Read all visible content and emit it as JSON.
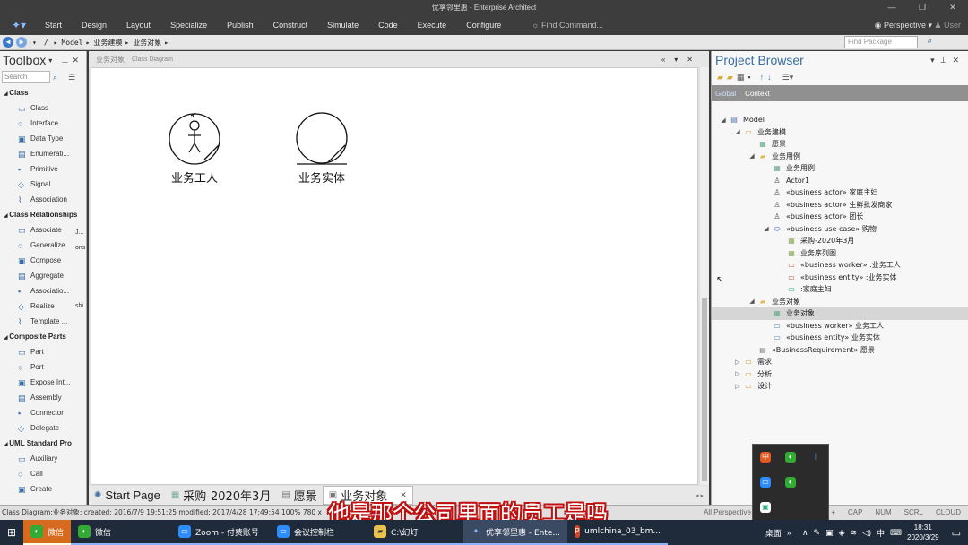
{
  "window": {
    "title": "优享邻里惠 - Enterprise Architect"
  },
  "menu": {
    "items": [
      "Start",
      "Design",
      "Layout",
      "Specialize",
      "Publish",
      "Construct",
      "Simulate",
      "Code",
      "Execute",
      "Configure"
    ],
    "find": "Find Command...",
    "perspective": "Perspective",
    "user": "User"
  },
  "nav": {
    "path": [
      "/",
      "Model",
      "业务建模",
      "业务对象"
    ],
    "find_package": "Find Package"
  },
  "toolbox": {
    "title": "Toolbox",
    "search": "Search",
    "sections": [
      {
        "title": "Class",
        "items": [
          "Class",
          "Interface",
          "Data Type",
          "Enumerati...",
          "Primitive",
          "Signal",
          "Association"
        ]
      },
      {
        "title": "Class Relationships",
        "items": [
          "Associate",
          "Generalize",
          "Compose",
          "Aggregate",
          "Associatio...",
          "Realize",
          "Template ..."
        ]
      },
      {
        "title": "Composite Parts",
        "items": [
          "Part",
          "Port",
          "Expose Int...",
          "Assembly",
          "Connector",
          "Delegate"
        ]
      },
      {
        "title": "UML Standard Pro",
        "items": [
          "Auxiliary",
          "Call",
          "Create"
        ]
      }
    ],
    "frags": [
      "J...",
      "ons",
      "shi"
    ]
  },
  "diagram": {
    "tab_name": "业务对象",
    "tab_type": "Class Diagram",
    "worker_label": "业务工人",
    "entity_label": "业务实体",
    "bottom_tabs": [
      "Start Page",
      "采购-2020年3月",
      "愿景",
      "业务对象"
    ]
  },
  "browser": {
    "title": "Project Browser",
    "tabs": [
      "Global",
      "Context"
    ],
    "tree": [
      {
        "label": "Model",
        "level": 0,
        "toggle": "◢",
        "icon": "model"
      },
      {
        "label": "业务建模",
        "level": 1,
        "toggle": "◢",
        "icon": "package"
      },
      {
        "label": "愿景",
        "level": 2,
        "toggle": "",
        "icon": "diagram"
      },
      {
        "label": "业务用例",
        "level": 2,
        "toggle": "◢",
        "icon": "folder"
      },
      {
        "label": "业务用例",
        "level": 3,
        "toggle": "",
        "icon": "diagram"
      },
      {
        "label": "Actor1",
        "level": 3,
        "toggle": "",
        "icon": "actor"
      },
      {
        "label": "«business actor» 家庭主妇",
        "level": 3,
        "toggle": "",
        "icon": "actor"
      },
      {
        "label": "«business actor» 生鲜批发商家",
        "level": 3,
        "toggle": "",
        "icon": "actor"
      },
      {
        "label": "«business actor» 团长",
        "level": 3,
        "toggle": "",
        "icon": "actor"
      },
      {
        "label": "«business use case» 购物",
        "level": 3,
        "toggle": "◢",
        "icon": "usecase"
      },
      {
        "label": "采购-2020年3月",
        "level": 4,
        "toggle": "",
        "icon": "seqdiag"
      },
      {
        "label": "业务序列图",
        "level": 4,
        "toggle": "",
        "icon": "seqdiag"
      },
      {
        "label": "«business worker» :业务工人",
        "level": 4,
        "toggle": "",
        "icon": "instance"
      },
      {
        "label": "«business entity» :业务实体",
        "level": 4,
        "toggle": "",
        "icon": "instance"
      },
      {
        "label": ":家庭主妇",
        "level": 4,
        "toggle": "",
        "icon": "lifeline"
      },
      {
        "label": "业务对象",
        "level": 2,
        "toggle": "◢",
        "icon": "folder"
      },
      {
        "label": "业务对象",
        "level": 3,
        "toggle": "",
        "icon": "diagram",
        "selected": true
      },
      {
        "label": "«business worker» 业务工人",
        "level": 3,
        "toggle": "",
        "icon": "class"
      },
      {
        "label": "«business entity» 业务实体",
        "level": 3,
        "toggle": "",
        "icon": "class"
      },
      {
        "label": "«BusinessRequirement» 愿景",
        "level": 2,
        "toggle": "",
        "icon": "req"
      },
      {
        "label": "需求",
        "level": 1,
        "toggle": "▷",
        "icon": "package"
      },
      {
        "label": "分析",
        "level": 1,
        "toggle": "▷",
        "icon": "package"
      },
      {
        "label": "设计",
        "level": 1,
        "toggle": "▷",
        "icon": "package"
      }
    ]
  },
  "status": {
    "left": "Class Diagram:业务对象:   created: 2016/7/9 19:51:25  modified: 2017/4/28 17:49:54   100%   780 x",
    "perspective": "All Perspective",
    "keys": [
      "CAP",
      "NUM",
      "SCRL",
      "CLOUD"
    ]
  },
  "subtitle": "他是那个公司里面的员工是吗",
  "taskbar": {
    "apps": [
      "微信",
      "微信",
      "Zoom - 付费账号",
      "会议控制栏",
      "C:\\幻灯",
      "优享邻里惠 - Ente...",
      "umlchina_03_bm...",
      "桌面"
    ],
    "time": "18:31",
    "date": "2020/3/29",
    "ime": "中"
  }
}
